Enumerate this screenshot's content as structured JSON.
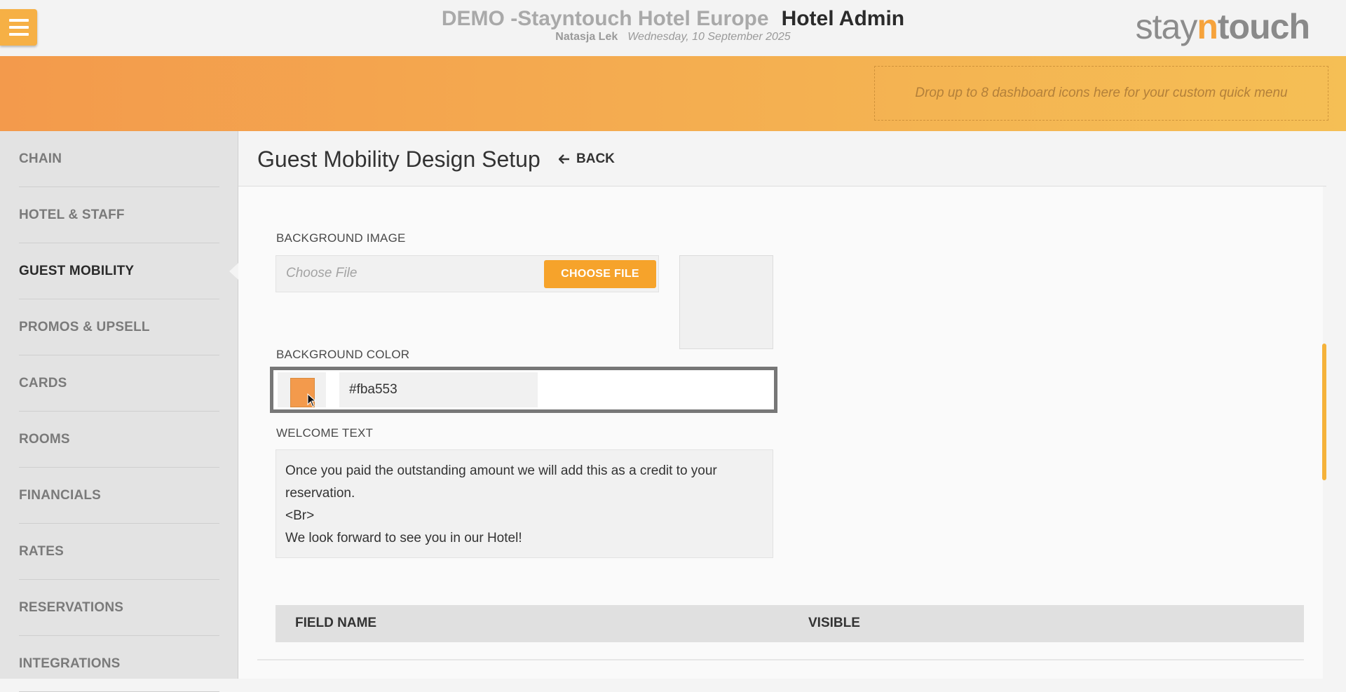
{
  "header": {
    "hotel_name": "DEMO -Stayntouch Hotel Europe",
    "app_name": "Hotel Admin",
    "user_name": "Natasja Lek",
    "date": "Wednesday, 10 September 2025",
    "logo": {
      "part1": "stay",
      "part2": "n",
      "part3": "touch"
    },
    "menu_icon": "hamburger-icon"
  },
  "quick_menu": {
    "placeholder": "Drop up to 8 dashboard icons here for your custom quick menu"
  },
  "sidebar": {
    "items": [
      {
        "label": "CHAIN",
        "active": false
      },
      {
        "label": "HOTEL & STAFF",
        "active": false
      },
      {
        "label": "GUEST MOBILITY",
        "active": true
      },
      {
        "label": "PROMOS & UPSELL",
        "active": false
      },
      {
        "label": "CARDS",
        "active": false
      },
      {
        "label": "ROOMS",
        "active": false
      },
      {
        "label": "FINANCIALS",
        "active": false
      },
      {
        "label": "RATES",
        "active": false
      },
      {
        "label": "RESERVATIONS",
        "active": false
      },
      {
        "label": "INTEGRATIONS",
        "active": false
      }
    ]
  },
  "main": {
    "title": "Guest Mobility Design Setup",
    "back_label": "BACK",
    "background_image": {
      "label": "BACKGROUND IMAGE",
      "placeholder": "Choose File",
      "button_label": "CHOOSE FILE"
    },
    "background_color": {
      "label": "BACKGROUND COLOR",
      "value": "#fba553",
      "swatch_color": "#f39a4c"
    },
    "welcome_text": {
      "label": "WELCOME TEXT",
      "value": "Once you paid the outstanding amount we will add this as a credit to your reservation.\n<Br>\nWe look forward to see you in our Hotel!"
    },
    "table": {
      "columns": [
        "FIELD NAME",
        "VISIBLE"
      ]
    }
  },
  "colors": {
    "accent": "#f6a32b",
    "band_start": "#f39a4c",
    "band_end": "#f5bf55"
  }
}
